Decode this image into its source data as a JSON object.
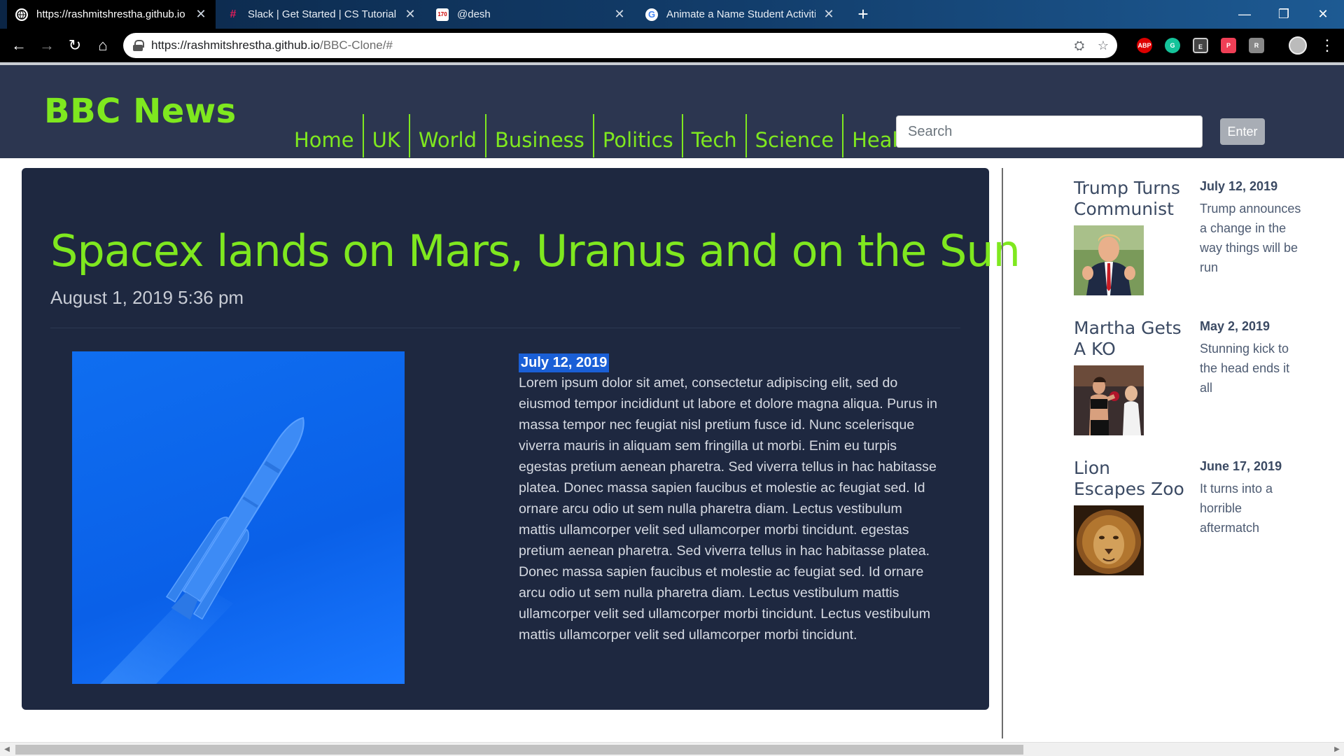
{
  "browser": {
    "tabs": [
      {
        "title": "https://rashmitshrestha.github.io",
        "favicon": "globe-icon",
        "active": true
      },
      {
        "title": "Slack | Get Started | CS Tutorial",
        "favicon": "slack-icon",
        "active": false
      },
      {
        "title": "@desh",
        "favicon": "calendar-icon",
        "active": false
      },
      {
        "title": "Animate a Name Student Activiti",
        "favicon": "google-icon",
        "active": false
      }
    ],
    "url_host": "https://rashmitshrestha.github.io",
    "url_path": "/BBC-Clone/#",
    "extensions": [
      "ABP",
      "G",
      "E",
      "P",
      "R"
    ]
  },
  "site": {
    "logo": "BBC News",
    "nav": [
      "Home",
      "UK",
      "World",
      "Business",
      "Politics",
      "Tech",
      "Science",
      "Health"
    ],
    "search_placeholder": "Search",
    "enter_label": "Enter",
    "accent_color": "#7fe81f",
    "header_color": "#2c3650"
  },
  "article": {
    "headline": "Spacex lands on Mars, Uranus and on the Sun",
    "published": "August 1, 2019 5:36 pm",
    "body_date": "July 12, 2019",
    "body": "Lorem ipsum dolor sit amet, consectetur adipiscing elit, sed do eiusmod tempor incididunt ut labore et dolore magna aliqua. Purus in massa tempor nec feugiat nisl pretium fusce id. Nunc scelerisque viverra mauris in aliquam sem fringilla ut morbi. Enim eu turpis egestas pretium aenean pharetra. Sed viverra tellus in hac habitasse platea. Donec massa sapien faucibus et molestie ac feugiat sed. Id ornare arcu odio ut sem nulla pharetra diam. Lectus vestibulum mattis ullamcorper velit sed ullamcorper morbi tincidunt. egestas pretium aenean pharetra. Sed viverra tellus in hac habitasse platea. Donec massa sapien faucibus et molestie ac feugiat sed. Id ornare arcu odio ut sem nulla pharetra diam. Lectus vestibulum mattis ullamcorper velit sed ullamcorper morbi tincidunt. Lectus vestibulum mattis ullamcorper velit sed ullamcorper morbi tincidunt."
  },
  "sidebar": {
    "stories": [
      {
        "title": "Trump Turns Communist",
        "date": "July 12, 2019",
        "desc": "Trump announces a change in the way things will be run"
      },
      {
        "title": "Martha Gets A KO",
        "date": "May 2, 2019",
        "desc": "Stunning kick to the head ends it all"
      },
      {
        "title": "Lion Escapes Zoo",
        "date": "June 17, 2019",
        "desc": "It turns into a horrible aftermatch"
      }
    ]
  }
}
